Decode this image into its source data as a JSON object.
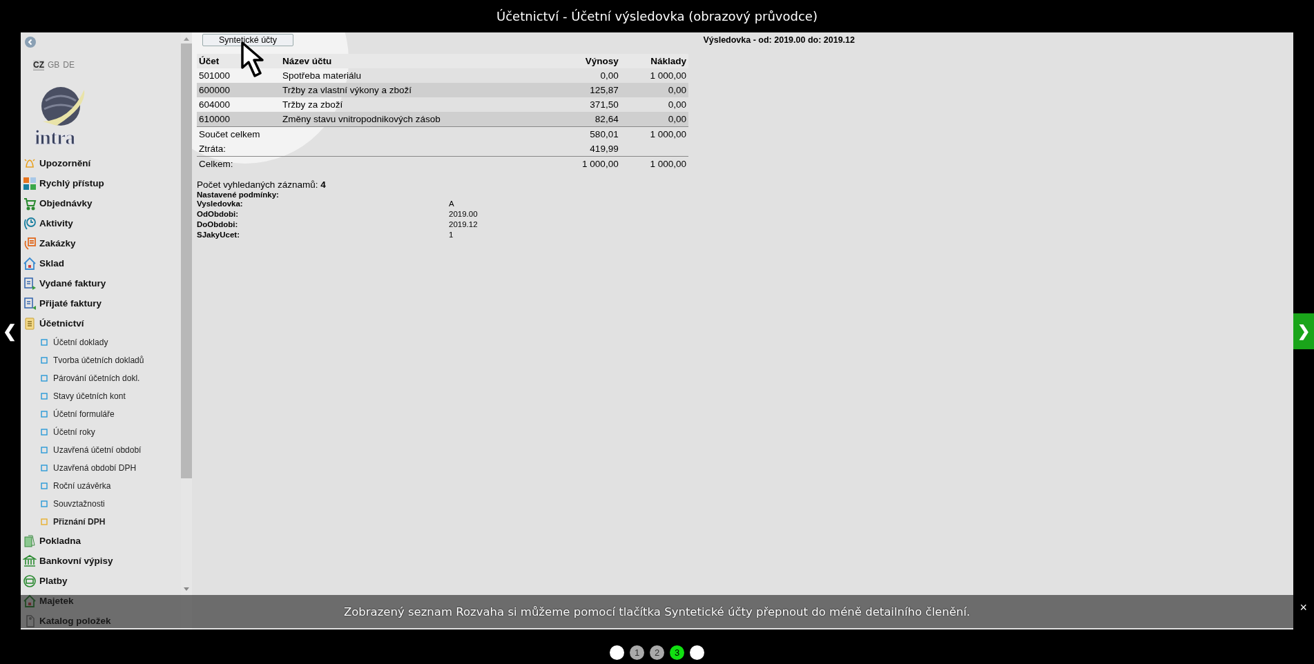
{
  "window": {
    "title": "Účetnictví - Účetní výsledovka (obrazový průvodce)"
  },
  "nav": {
    "prev": "❮",
    "next": "❯"
  },
  "languages": [
    {
      "label": "CZ",
      "selected": true
    },
    {
      "label": "GB",
      "selected": false
    },
    {
      "label": "DE",
      "selected": false
    }
  ],
  "logo_text": "intra",
  "sidebar": {
    "items": [
      {
        "label": "Upozornění",
        "kind": "main"
      },
      {
        "label": "Rychlý přístup",
        "kind": "main"
      },
      {
        "label": "Objednávky",
        "kind": "main"
      },
      {
        "label": "Aktivity",
        "kind": "main"
      },
      {
        "label": "Zakázky",
        "kind": "main"
      },
      {
        "label": "Sklad",
        "kind": "main"
      },
      {
        "label": "Vydané faktury",
        "kind": "main"
      },
      {
        "label": "Přijaté faktury",
        "kind": "main"
      },
      {
        "label": "Účetnictví",
        "kind": "main",
        "children": [
          {
            "label": "Účetní doklady",
            "kind": "page"
          },
          {
            "label": "Tvorba účetních dokladů",
            "kind": "page"
          },
          {
            "label": "Párování účetních dokl.",
            "kind": "page"
          },
          {
            "label": "Stavy účetních kont",
            "kind": "page"
          },
          {
            "label": "Účetní formuláře",
            "kind": "page"
          },
          {
            "label": "Účetní roky",
            "kind": "page"
          },
          {
            "label": "Uzavřená účetní období",
            "kind": "page"
          },
          {
            "label": "Uzavřená období DPH",
            "kind": "page"
          },
          {
            "label": "Roční uzávěrka",
            "kind": "page"
          },
          {
            "label": "Souvztažnosti",
            "kind": "page"
          },
          {
            "label": "Přiznání DPH",
            "kind": "folder"
          }
        ]
      },
      {
        "label": "Pokladna",
        "kind": "main"
      },
      {
        "label": "Bankovní výpisy",
        "kind": "main"
      },
      {
        "label": "Platby",
        "kind": "main"
      },
      {
        "label": "Majetek",
        "kind": "main"
      },
      {
        "label": "Katalog položek",
        "kind": "main"
      }
    ]
  },
  "toolbar": {
    "button": "Syntetické účty",
    "report_title": "Výsledovka - od: 2019.00 do: 2019.12"
  },
  "table": {
    "columns": [
      "Účet",
      "Název účtu",
      "Výnosy",
      "Náklady"
    ],
    "rows": [
      [
        "501000",
        "Spotřeba materiálu",
        "0,00",
        "1 000,00"
      ],
      [
        "600000",
        "Tržby za vlastní výkony a zboží",
        "125,87",
        "0,00"
      ],
      [
        "604000",
        "Tržby za zboží",
        "371,50",
        "0,00"
      ],
      [
        "610000",
        "Změny stavu vnitropodnikových zásob",
        "82,64",
        "0,00"
      ]
    ],
    "totals": [
      {
        "label": "Součet celkem",
        "revenue": "580,01",
        "costs": "1 000,00"
      },
      {
        "label": "Ztráta:",
        "revenue": "419,99"
      },
      {
        "label": "Celkem:",
        "revenue": "1 000,00",
        "costs": "1 000,00"
      }
    ]
  },
  "summary": {
    "count_label": "Počet vyhledaných záznamů:",
    "count": "4",
    "conditions_title": "Nastavené podmínky:",
    "conditions": [
      {
        "name": "Vysledovka:",
        "value": "A"
      },
      {
        "name": "OdObdobi:",
        "value": "2019.00"
      },
      {
        "name": "DoObdobi:",
        "value": "2019.12"
      },
      {
        "name": "SJakyUcet:",
        "value": "1"
      }
    ]
  },
  "caption": {
    "text": "Zobrazený seznam Rozvaha si můžeme pomocí tlačítka Syntetické účty přepnout do méně detailního členění.",
    "close": "×"
  },
  "pager": [
    {
      "selected": false
    },
    {
      "label": "1",
      "selected": false
    },
    {
      "label": "2",
      "selected": false
    },
    {
      "label": "3",
      "selected": true
    },
    {
      "selected": false
    }
  ]
}
